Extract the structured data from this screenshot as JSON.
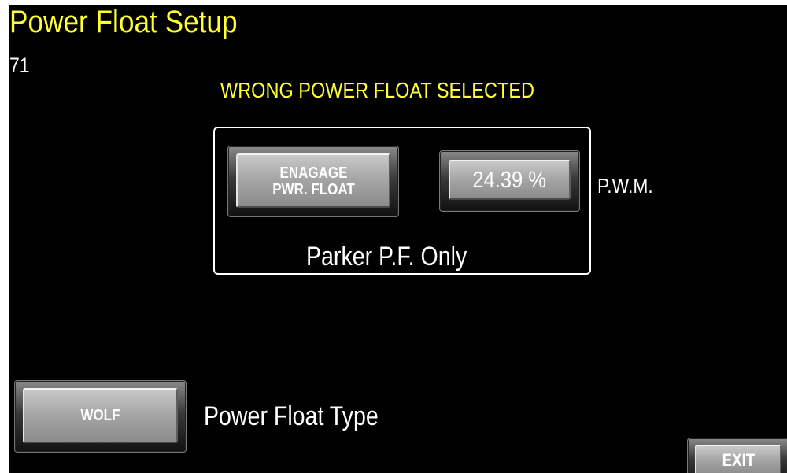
{
  "header": {
    "title": "Power Float Setup",
    "screen_number": "71"
  },
  "status": {
    "warning": "WRONG POWER FLOAT SELECTED"
  },
  "power_float_panel": {
    "engage_button_line1": "ENAGAGE",
    "engage_button_line2": "PWR. FLOAT",
    "pwm_value": "24.39 %",
    "pwm_label": "P.W.M.",
    "note": "Parker P.F. Only"
  },
  "power_float_type": {
    "button_label": "WOLF",
    "label": "Power Float Type"
  },
  "navigation": {
    "exit_label": "EXIT"
  },
  "colors": {
    "background": "#000000",
    "title": "#ffff33",
    "warning": "#ffff33",
    "text": "#ffffff",
    "button_face": "#a4a4a4"
  }
}
